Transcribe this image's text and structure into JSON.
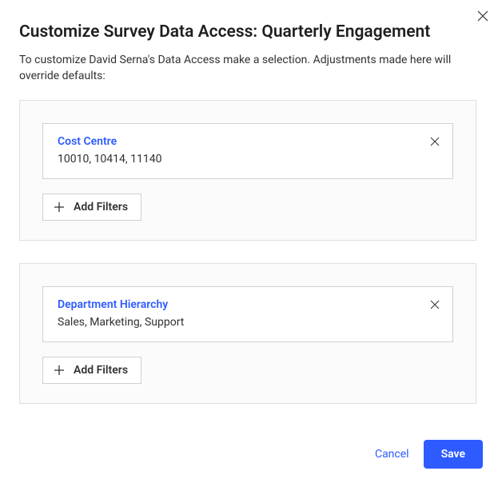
{
  "dialog": {
    "title": "Customize Survey Data Access: Quarterly Engagement",
    "description": "To customize David Serna's Data Access make a selection. Adjustments made here will override defaults:"
  },
  "groups": [
    {
      "filter_label": "Cost Centre",
      "filter_value": "10010, 10414, 11140",
      "add_label": "Add Filters"
    },
    {
      "filter_label": "Department Hierarchy",
      "filter_value": "Sales, Marketing, Support",
      "add_label": "Add Filters"
    }
  ],
  "footer": {
    "cancel": "Cancel",
    "save": "Save"
  }
}
